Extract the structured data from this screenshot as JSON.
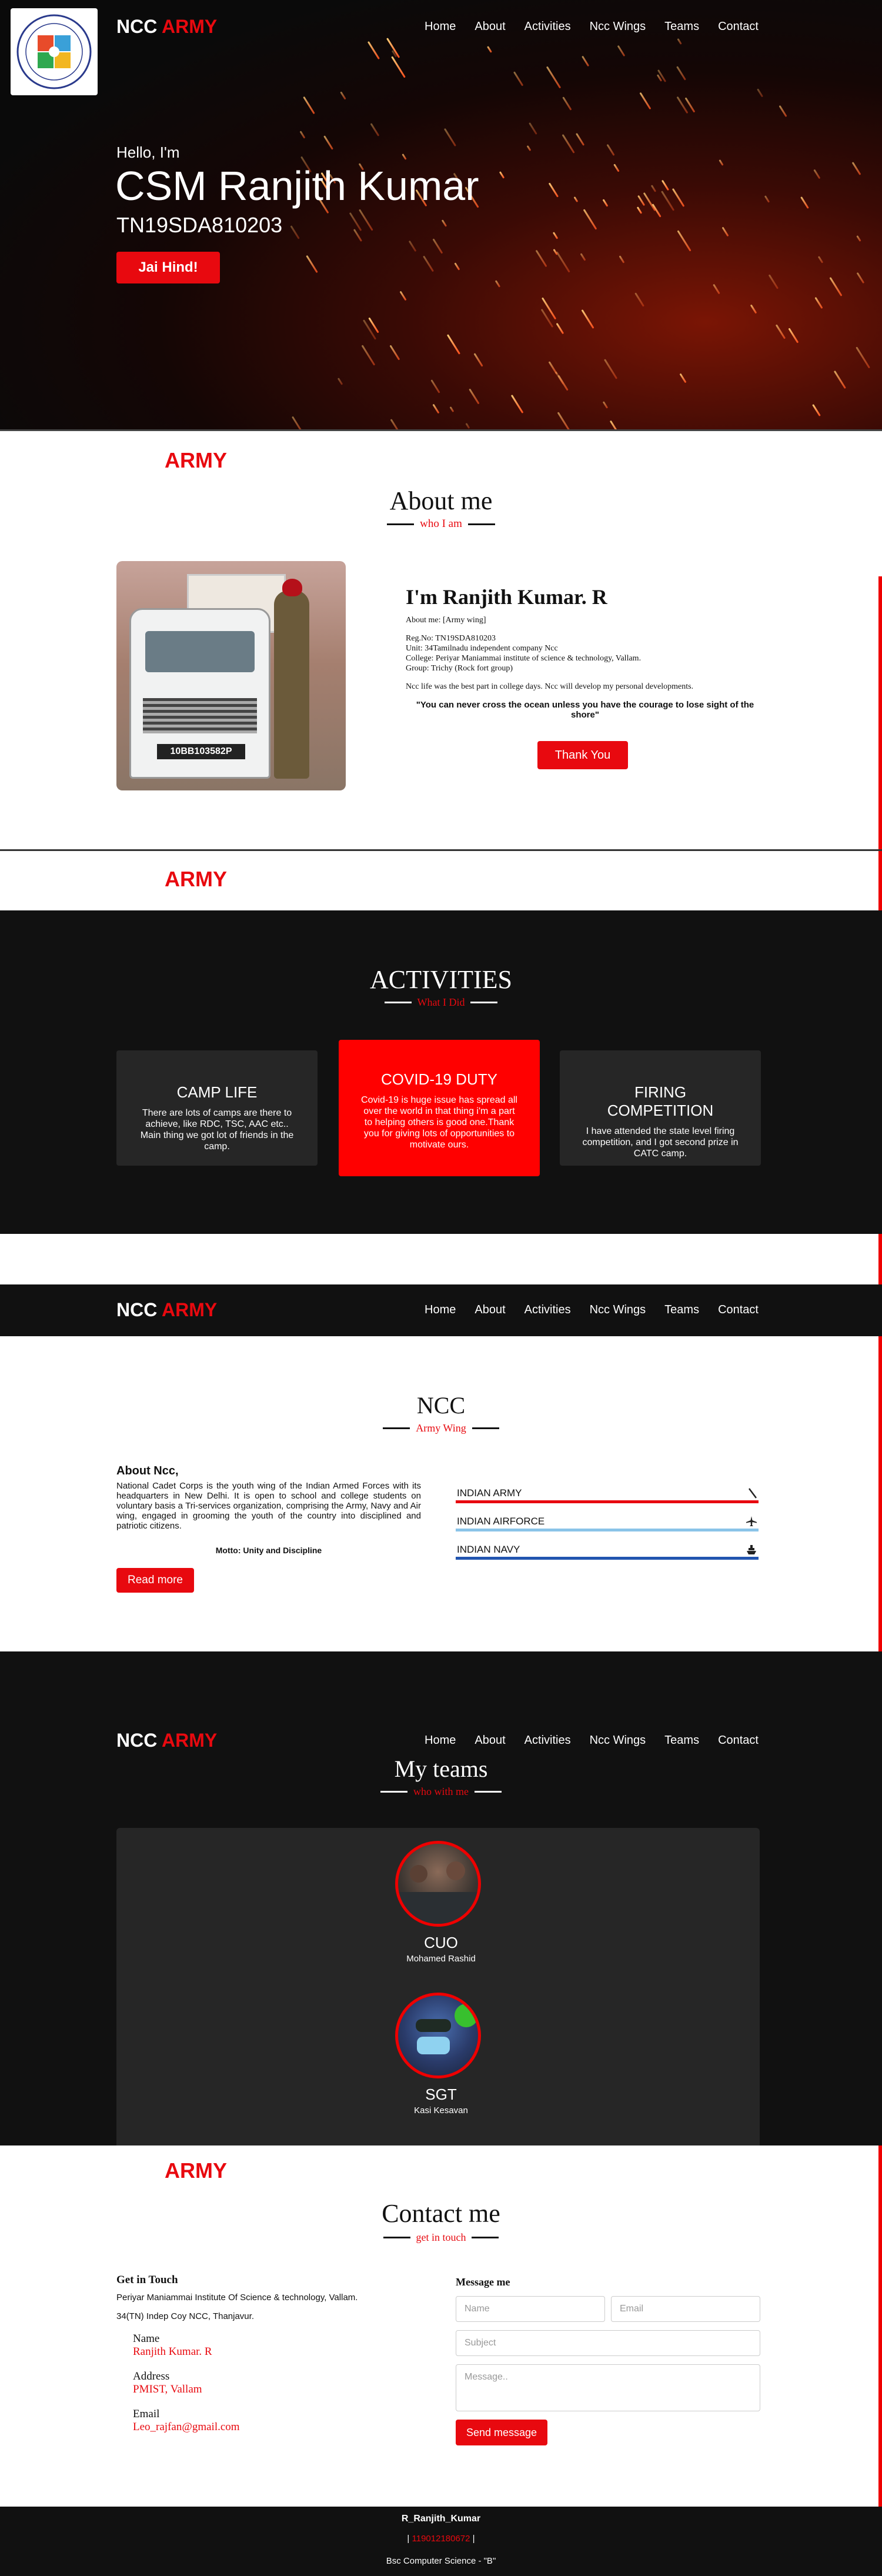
{
  "brand": {
    "ncc": "NCC",
    "army": "ARMY"
  },
  "nav": {
    "items": [
      "Home",
      "About",
      "Activities",
      "Ncc Wings",
      "Teams",
      "Contact"
    ]
  },
  "hero": {
    "greeting": "Hello, I'm",
    "name": "CSM Ranjith Kumar",
    "regno": "TN19SDA810203",
    "button": "Jai Hind!"
  },
  "logo": {
    "text": "MANIAMMAI INSTITUTE OF SCIENCE"
  },
  "section_label": "ARMY",
  "about": {
    "title": "About me",
    "subtitle": "who I am",
    "heading": "I'm Ranjith Kumar. R",
    "about_me": "About me: [Army wing]",
    "reg": "Reg.No: TN19SDA810203",
    "unit": "Unit: 34Tamilnadu independent company Ncc",
    "college": "College: Periyar Maniammai institute of science & technology, Vallam.",
    "group": "Group: Trichy (Rock fort group)",
    "life": "Ncc life was the best part in college days. Ncc will develop my personal developments.",
    "quote": "\"You can never cross the ocean unless you have the courage to lose sight of the shore\"",
    "button": "Thank You",
    "vehicle_plate": "10BB103582P"
  },
  "activities": {
    "title": "ACTIVITIES",
    "subtitle": "What I Did",
    "cards": [
      {
        "title": "CAMP LIFE",
        "text": "There are lots of camps are there to achieve, like RDC, TSC, AAC etc.. Main thing we got lot of friends in the camp."
      },
      {
        "title": "COVID-19 DUTY",
        "text": "Covid-19 is huge issue has spread all over the world in that thing i'm a part to helping others is good one.Thank you for giving lots of opportunities to motivate ours."
      },
      {
        "title": "FIRING COMPETITION",
        "text": "I have attended the state level firing competition, and I got second prize in CATC camp."
      }
    ]
  },
  "ncc": {
    "title": "NCC",
    "subtitle": "Army Wing",
    "about_heading": "About Ncc,",
    "about_text": "National Cadet Corps is the youth wing of the Indian Armed Forces with its headquarters in New Delhi. It is open to school and college students on voluntary basis a Tri-services organization, comprising the Army, Navy and Air wing, engaged in grooming the youth of the country into disciplined and patriotic citizens.",
    "motto": "Motto: Unity and Discipline",
    "button": "Read more",
    "wings": [
      {
        "label": "INDIAN ARMY",
        "icon": "rifle-icon",
        "color": "#e8090f"
      },
      {
        "label": "INDIAN AIRFORCE",
        "icon": "plane-icon",
        "color": "#8ac4e8"
      },
      {
        "label": "INDIAN NAVY",
        "icon": "ship-icon",
        "color": "#2255b0"
      }
    ]
  },
  "teams": {
    "title": "My teams",
    "subtitle": "who with me",
    "members": [
      {
        "rank": "CUO",
        "name": "Mohamed Rashid"
      },
      {
        "rank": "SGT",
        "name": "Kasi Kesavan"
      }
    ]
  },
  "contact": {
    "title": "Contact me",
    "subtitle": "get in touch",
    "touch_heading": "Get in Touch",
    "institute": "Periyar Maniammai Institute Of Science & technology, Vallam.",
    "unit": "34(TN) Indep Coy NCC, Thanjavur.",
    "name_label": "Name",
    "name_value": "Ranjith Kumar. R",
    "address_label": "Address",
    "address_value": "PMIST, Vallam",
    "email_label": "Email",
    "email_value": "Leo_rajfan@gmail.com",
    "message_heading": "Message me",
    "placeholders": {
      "name": "Name",
      "email": "Email",
      "subject": "Subject",
      "message": "Message.."
    },
    "button": "Send message"
  },
  "footer": {
    "username": "R_Ranjith_Kumar",
    "phone_prefix": "| ",
    "phone": "119012180672",
    "phone_suffix": " |",
    "degree": "Bsc Computer Science - \"B\""
  },
  "colors": {
    "accent": "#e8090f",
    "dark": "#111111",
    "card": "#262626"
  }
}
